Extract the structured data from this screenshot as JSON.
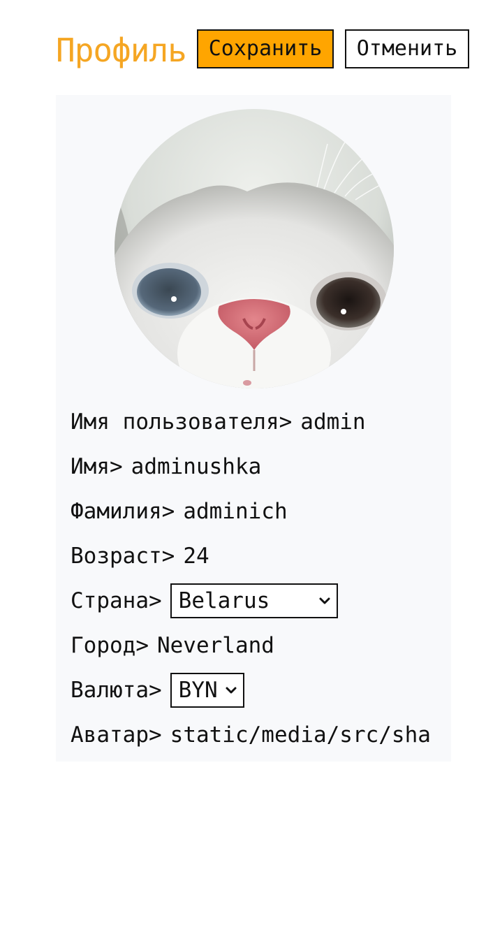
{
  "header": {
    "title": "Профиль",
    "save_label": "Сохранить",
    "cancel_label": "Отменить"
  },
  "profile": {
    "username_label": "Имя пользователя>",
    "username": "admin",
    "first_name_label": "Имя>",
    "first_name": "adminushka",
    "last_name_label": "Фамилия>",
    "last_name": "adminich",
    "age_label": "Возраст>",
    "age": "24",
    "country_label": "Страна>",
    "country": "Belarus",
    "city_label": "Город>",
    "city": "Neverland",
    "currency_label": "Валюта>",
    "currency": "BYN",
    "avatar_label": "Аватар>",
    "avatar_path": "static/media/src/sha"
  },
  "colors": {
    "accent": "#f5a623",
    "save_button": "#ffa500",
    "card_background": "#f8f9fb"
  },
  "icons": {
    "avatar_image": "cat-photo",
    "select_arrow": "chevron-down-icon"
  }
}
